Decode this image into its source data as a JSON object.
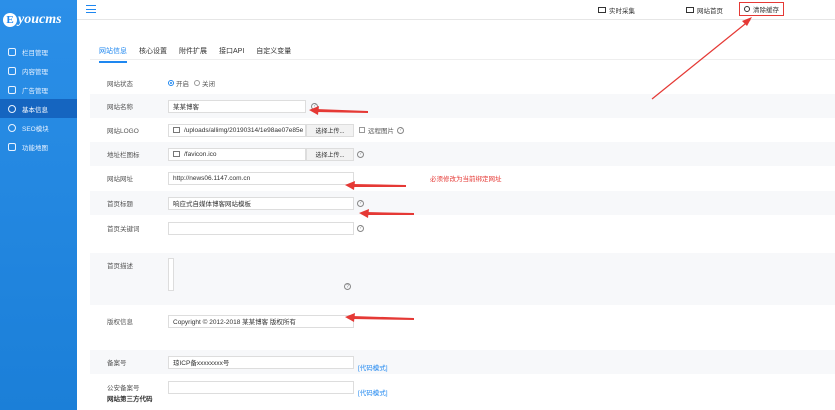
{
  "logo": {
    "letter": "E",
    "text": "youcms"
  },
  "sidebar": {
    "items": [
      {
        "label": "栏目管理",
        "icon": "grid-icon"
      },
      {
        "label": "内容管理",
        "icon": "document-icon"
      },
      {
        "label": "广告管理",
        "icon": "image-icon"
      },
      {
        "label": "基本信息",
        "icon": "gear-icon"
      },
      {
        "label": "SEO模块",
        "icon": "search-icon"
      },
      {
        "label": "功能地图",
        "icon": "map-icon"
      }
    ],
    "active_index": 3
  },
  "topbar": {
    "collect": "实时采集",
    "home": "网站首页",
    "clear": "清除缓存"
  },
  "tabs": [
    "网站信息",
    "核心设置",
    "附件扩展",
    "接口API",
    "自定义变量"
  ],
  "form": {
    "status_label": "网站状态",
    "status_on": "开启",
    "status_off": "关闭",
    "name_label": "网站名称",
    "name_value": "某某博客",
    "logo_label": "网站LOGO",
    "logo_value": "/uploads/allimg/20190314/1e98ae07e85e",
    "logo_upload": "选择上传...",
    "logo_remote": "远程图片",
    "favicon_label": "地址栏图标",
    "favicon_value": "/favicon.ico",
    "favicon_upload": "选择上传...",
    "url_label": "网站网址",
    "url_value": "http://news06.1147.com.cn",
    "url_note": "必须修改为当前绑定网址",
    "title_label": "首页标题",
    "title_value": "响应式自媒体博客网站模板",
    "keywords_label": "首页关键词",
    "keywords_value": "",
    "desc_label": "首页描述",
    "desc_value": "",
    "copyright_label": "版权信息",
    "copyright_value": "Copyright © 2012-2018 某某博客 版权所有",
    "icp_label": "备案号",
    "icp_value": "琼ICP备xxxxxxxx号",
    "icp_link": "[代码模式]",
    "police_label": "公安备案号",
    "police_value": "",
    "police_link": "[代码模式]",
    "thirdparty_label": "网站第三方代码"
  },
  "colors": {
    "primary": "#1e87f0",
    "arrow": "#e53935",
    "sidebar_active": "#1565c0"
  }
}
